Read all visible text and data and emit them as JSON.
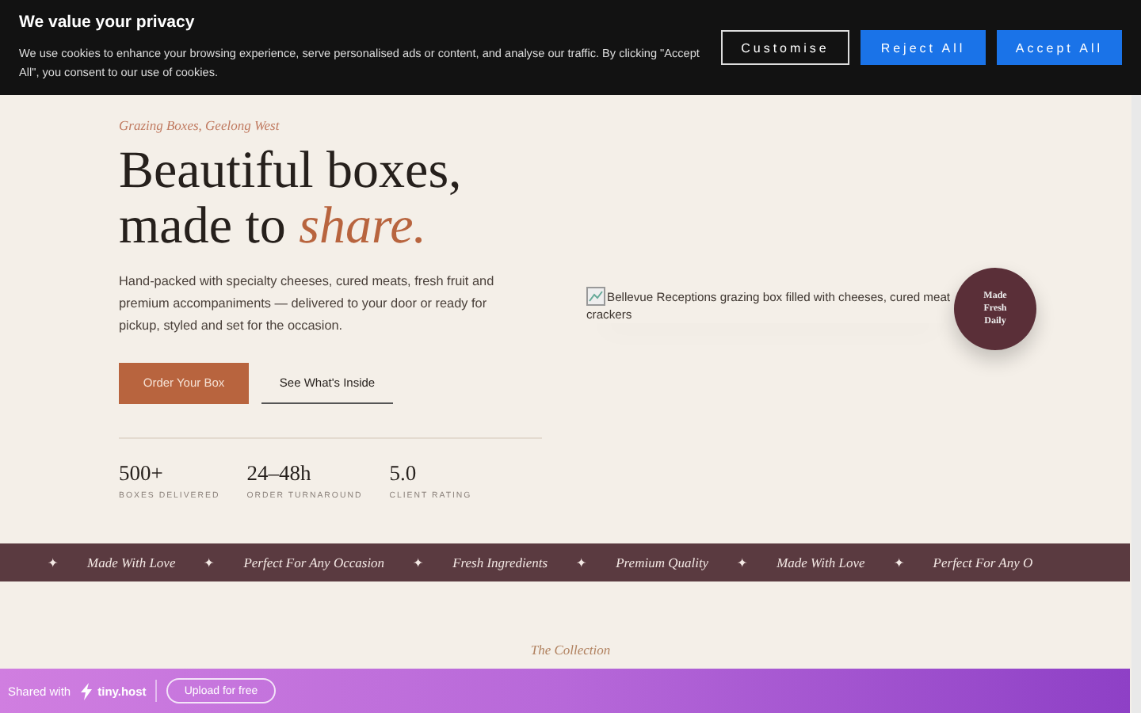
{
  "cookie_banner": {
    "title": "We value your privacy",
    "text": "We use cookies to enhance your browsing experience, serve personalised ads or content, and analyse our traffic. By clicking \"Accept All\", you consent to our use of cookies.",
    "buttons": [
      {
        "label": "Customise",
        "kind": "outline"
      },
      {
        "label": "Reject All",
        "kind": "solid"
      },
      {
        "label": "Accept All",
        "kind": "solid"
      }
    ]
  },
  "hero": {
    "eyebrow": "Grazing Boxes, Geelong West",
    "headline_line1": "Beautiful boxes,",
    "headline_line2": "made to",
    "headline_accent": "share.",
    "description": "Hand-packed with specialty cheeses, cured meats, fresh fruit and premium accompaniments — delivered to your door or ready for pickup, styled and set for the occasion.",
    "buttons": [
      {
        "label": "Order Your Box",
        "kind": "primary"
      },
      {
        "label": "See What's Inside",
        "kind": "link"
      }
    ],
    "stats": [
      {
        "value": "500+",
        "label": "BOXES DELIVERED"
      },
      {
        "value": "24–48h",
        "label": "ORDER TURNAROUND"
      },
      {
        "value": "5.0",
        "label": "CLIENT RATING"
      }
    ],
    "image_alt_lines": [
      "Bellevue Receptions grazing box filled with cheeses, cured meat",
      "crackers"
    ],
    "badge": "Made Fresh Daily"
  },
  "marquee": {
    "separator": "✦",
    "items": [
      "Made With Love",
      "Perfect For Any Occasion",
      "Fresh Ingredients",
      "Premium Quality",
      "Made With Love",
      "Perfect For Any O"
    ]
  },
  "next_section": {
    "eyebrow": "The Collection"
  },
  "share_bar": {
    "prefix": "Shared with",
    "brand": "tiny.host",
    "button": "Upload for free"
  }
}
